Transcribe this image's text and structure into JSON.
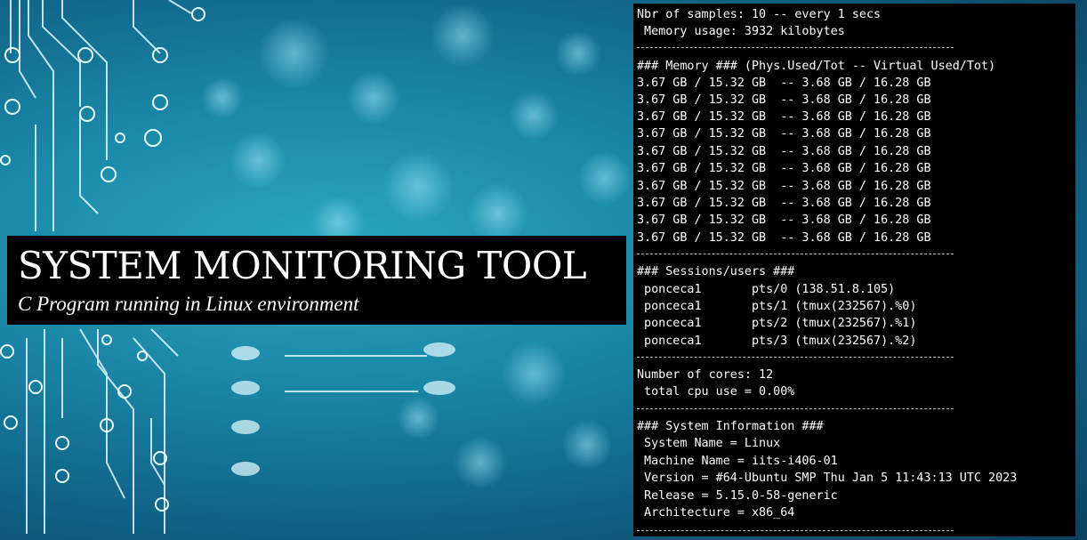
{
  "slide": {
    "title": "SYSTEM MONITORING TOOL",
    "subtitle": "C Program running in Linux environment"
  },
  "terminal": {
    "samples_line": "Nbr of samples: 10 -- every 1 secs",
    "memory_usage_line": " Memory usage: 3932 kilobytes",
    "memory_header": "### Memory ### (Phys.Used/Tot -- Virtual Used/Tot)",
    "memory_rows": [
      "3.67 GB / 15.32 GB  -- 3.68 GB / 16.28 GB",
      "3.67 GB / 15.32 GB  -- 3.68 GB / 16.28 GB",
      "3.67 GB / 15.32 GB  -- 3.68 GB / 16.28 GB",
      "3.67 GB / 15.32 GB  -- 3.68 GB / 16.28 GB",
      "3.67 GB / 15.32 GB  -- 3.68 GB / 16.28 GB",
      "3.67 GB / 15.32 GB  -- 3.68 GB / 16.28 GB",
      "3.67 GB / 15.32 GB  -- 3.68 GB / 16.28 GB",
      "3.67 GB / 15.32 GB  -- 3.68 GB / 16.28 GB",
      "3.67 GB / 15.32 GB  -- 3.68 GB / 16.28 GB",
      "3.67 GB / 15.32 GB  -- 3.68 GB / 16.28 GB"
    ],
    "sessions_header": "### Sessions/users ###",
    "sessions": [
      " ponceca1       pts/0 (138.51.8.105)",
      " ponceca1       pts/1 (tmux(232567).%0)",
      " ponceca1       pts/2 (tmux(232567).%1)",
      " ponceca1       pts/3 (tmux(232567).%2)"
    ],
    "cores_line": "Number of cores: 12",
    "cpu_line": " total cpu use = 0.00%",
    "sysinfo_header": "### System Information ###",
    "sysinfo": [
      " System Name = Linux",
      " Machine Name = iits-i406-01",
      " Version = #64-Ubuntu SMP Thu Jan 5 11:43:13 UTC 2023",
      " Release = 5.15.0-58-generic",
      " Architecture = x86_64"
    ]
  }
}
